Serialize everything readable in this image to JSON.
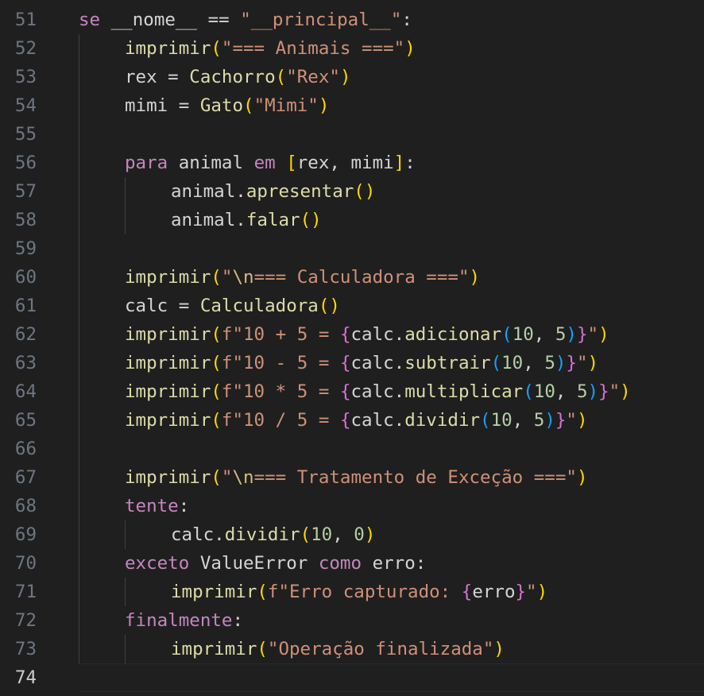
{
  "editor": {
    "current_line": "74",
    "lines": [
      {
        "num": "51",
        "indent": 0,
        "tokens": [
          {
            "t": "se",
            "c": "kw"
          },
          {
            "t": " __nome__ ",
            "c": "tx"
          },
          {
            "t": "==",
            "c": "op"
          },
          {
            "t": " ",
            "c": "tx"
          },
          {
            "t": "\"__principal__\"",
            "c": "st"
          },
          {
            "t": ":",
            "c": "tx"
          }
        ]
      },
      {
        "num": "52",
        "indent": 1,
        "tokens": [
          {
            "t": "imprimir",
            "c": "fn"
          },
          {
            "t": "(",
            "c": "br1"
          },
          {
            "t": "\"=== Animais ===\"",
            "c": "st"
          },
          {
            "t": ")",
            "c": "br1"
          }
        ]
      },
      {
        "num": "53",
        "indent": 1,
        "tokens": [
          {
            "t": "rex",
            "c": "tx"
          },
          {
            "t": " = ",
            "c": "op"
          },
          {
            "t": "Cachorro",
            "c": "fn"
          },
          {
            "t": "(",
            "c": "br1"
          },
          {
            "t": "\"Rex\"",
            "c": "st"
          },
          {
            "t": ")",
            "c": "br1"
          }
        ]
      },
      {
        "num": "54",
        "indent": 1,
        "tokens": [
          {
            "t": "mimi",
            "c": "tx"
          },
          {
            "t": " = ",
            "c": "op"
          },
          {
            "t": "Gato",
            "c": "fn"
          },
          {
            "t": "(",
            "c": "br1"
          },
          {
            "t": "\"Mimi\"",
            "c": "st"
          },
          {
            "t": ")",
            "c": "br1"
          }
        ]
      },
      {
        "num": "55",
        "indent": 0,
        "tokens": []
      },
      {
        "num": "56",
        "indent": 1,
        "tokens": [
          {
            "t": "para",
            "c": "kw"
          },
          {
            "t": " animal ",
            "c": "tx"
          },
          {
            "t": "em",
            "c": "kw"
          },
          {
            "t": " ",
            "c": "tx"
          },
          {
            "t": "[",
            "c": "br1"
          },
          {
            "t": "rex, mimi",
            "c": "tx"
          },
          {
            "t": "]",
            "c": "br1"
          },
          {
            "t": ":",
            "c": "tx"
          }
        ]
      },
      {
        "num": "57",
        "indent": 2,
        "tokens": [
          {
            "t": "animal.",
            "c": "tx"
          },
          {
            "t": "apresentar",
            "c": "fn"
          },
          {
            "t": "()",
            "c": "br1"
          }
        ]
      },
      {
        "num": "58",
        "indent": 2,
        "tokens": [
          {
            "t": "animal.",
            "c": "tx"
          },
          {
            "t": "falar",
            "c": "fn"
          },
          {
            "t": "()",
            "c": "br1"
          }
        ]
      },
      {
        "num": "59",
        "indent": 0,
        "tokens": []
      },
      {
        "num": "60",
        "indent": 1,
        "tokens": [
          {
            "t": "imprimir",
            "c": "fn"
          },
          {
            "t": "(",
            "c": "br1"
          },
          {
            "t": "\"",
            "c": "st"
          },
          {
            "t": "\\n",
            "c": "es"
          },
          {
            "t": "=== Calculadora ===\"",
            "c": "st"
          },
          {
            "t": ")",
            "c": "br1"
          }
        ]
      },
      {
        "num": "61",
        "indent": 1,
        "tokens": [
          {
            "t": "calc",
            "c": "tx"
          },
          {
            "t": " = ",
            "c": "op"
          },
          {
            "t": "Calculadora",
            "c": "fn"
          },
          {
            "t": "()",
            "c": "br1"
          }
        ]
      },
      {
        "num": "62",
        "indent": 1,
        "tokens": [
          {
            "t": "imprimir",
            "c": "fn"
          },
          {
            "t": "(",
            "c": "br1"
          },
          {
            "t": "f\"10 + 5 = ",
            "c": "st"
          },
          {
            "t": "{",
            "c": "br2"
          },
          {
            "t": "calc.",
            "c": "tx"
          },
          {
            "t": "adicionar",
            "c": "fn"
          },
          {
            "t": "(",
            "c": "br3"
          },
          {
            "t": "10",
            "c": "nu"
          },
          {
            "t": ", ",
            "c": "tx"
          },
          {
            "t": "5",
            "c": "nu"
          },
          {
            "t": ")",
            "c": "br3"
          },
          {
            "t": "}",
            "c": "br2"
          },
          {
            "t": "\"",
            "c": "st"
          },
          {
            "t": ")",
            "c": "br1"
          }
        ]
      },
      {
        "num": "63",
        "indent": 1,
        "tokens": [
          {
            "t": "imprimir",
            "c": "fn"
          },
          {
            "t": "(",
            "c": "br1"
          },
          {
            "t": "f\"10 - 5 = ",
            "c": "st"
          },
          {
            "t": "{",
            "c": "br2"
          },
          {
            "t": "calc.",
            "c": "tx"
          },
          {
            "t": "subtrair",
            "c": "fn"
          },
          {
            "t": "(",
            "c": "br3"
          },
          {
            "t": "10",
            "c": "nu"
          },
          {
            "t": ", ",
            "c": "tx"
          },
          {
            "t": "5",
            "c": "nu"
          },
          {
            "t": ")",
            "c": "br3"
          },
          {
            "t": "}",
            "c": "br2"
          },
          {
            "t": "\"",
            "c": "st"
          },
          {
            "t": ")",
            "c": "br1"
          }
        ]
      },
      {
        "num": "64",
        "indent": 1,
        "tokens": [
          {
            "t": "imprimir",
            "c": "fn"
          },
          {
            "t": "(",
            "c": "br1"
          },
          {
            "t": "f\"10 * 5 = ",
            "c": "st"
          },
          {
            "t": "{",
            "c": "br2"
          },
          {
            "t": "calc.",
            "c": "tx"
          },
          {
            "t": "multiplicar",
            "c": "fn"
          },
          {
            "t": "(",
            "c": "br3"
          },
          {
            "t": "10",
            "c": "nu"
          },
          {
            "t": ", ",
            "c": "tx"
          },
          {
            "t": "5",
            "c": "nu"
          },
          {
            "t": ")",
            "c": "br3"
          },
          {
            "t": "}",
            "c": "br2"
          },
          {
            "t": "\"",
            "c": "st"
          },
          {
            "t": ")",
            "c": "br1"
          }
        ]
      },
      {
        "num": "65",
        "indent": 1,
        "tokens": [
          {
            "t": "imprimir",
            "c": "fn"
          },
          {
            "t": "(",
            "c": "br1"
          },
          {
            "t": "f\"10 / 5 = ",
            "c": "st"
          },
          {
            "t": "{",
            "c": "br2"
          },
          {
            "t": "calc.",
            "c": "tx"
          },
          {
            "t": "dividir",
            "c": "fn"
          },
          {
            "t": "(",
            "c": "br3"
          },
          {
            "t": "10",
            "c": "nu"
          },
          {
            "t": ", ",
            "c": "tx"
          },
          {
            "t": "5",
            "c": "nu"
          },
          {
            "t": ")",
            "c": "br3"
          },
          {
            "t": "}",
            "c": "br2"
          },
          {
            "t": "\"",
            "c": "st"
          },
          {
            "t": ")",
            "c": "br1"
          }
        ]
      },
      {
        "num": "66",
        "indent": 0,
        "tokens": []
      },
      {
        "num": "67",
        "indent": 1,
        "tokens": [
          {
            "t": "imprimir",
            "c": "fn"
          },
          {
            "t": "(",
            "c": "br1"
          },
          {
            "t": "\"",
            "c": "st"
          },
          {
            "t": "\\n",
            "c": "es"
          },
          {
            "t": "=== Tratamento de Exceção ===\"",
            "c": "st"
          },
          {
            "t": ")",
            "c": "br1"
          }
        ]
      },
      {
        "num": "68",
        "indent": 1,
        "tokens": [
          {
            "t": "tente",
            "c": "kw"
          },
          {
            "t": ":",
            "c": "tx"
          }
        ]
      },
      {
        "num": "69",
        "indent": 2,
        "tokens": [
          {
            "t": "calc.",
            "c": "tx"
          },
          {
            "t": "dividir",
            "c": "fn"
          },
          {
            "t": "(",
            "c": "br1"
          },
          {
            "t": "10",
            "c": "nu"
          },
          {
            "t": ", ",
            "c": "tx"
          },
          {
            "t": "0",
            "c": "nu"
          },
          {
            "t": ")",
            "c": "br1"
          }
        ]
      },
      {
        "num": "70",
        "indent": 1,
        "tokens": [
          {
            "t": "exceto",
            "c": "kw"
          },
          {
            "t": " ValueError ",
            "c": "tx"
          },
          {
            "t": "como",
            "c": "kw"
          },
          {
            "t": " erro:",
            "c": "tx"
          }
        ]
      },
      {
        "num": "71",
        "indent": 2,
        "tokens": [
          {
            "t": "imprimir",
            "c": "fn"
          },
          {
            "t": "(",
            "c": "br1"
          },
          {
            "t": "f\"Erro capturado: ",
            "c": "st"
          },
          {
            "t": "{",
            "c": "br2"
          },
          {
            "t": "erro",
            "c": "tx"
          },
          {
            "t": "}",
            "c": "br2"
          },
          {
            "t": "\"",
            "c": "st"
          },
          {
            "t": ")",
            "c": "br1"
          }
        ]
      },
      {
        "num": "72",
        "indent": 1,
        "tokens": [
          {
            "t": "finalmente",
            "c": "kw"
          },
          {
            "t": ":",
            "c": "tx"
          }
        ]
      },
      {
        "num": "73",
        "indent": 2,
        "tokens": [
          {
            "t": "imprimir",
            "c": "fn"
          },
          {
            "t": "(",
            "c": "br1"
          },
          {
            "t": "\"Operação finalizada\"",
            "c": "st"
          },
          {
            "t": ")",
            "c": "br1"
          }
        ]
      },
      {
        "num": "74",
        "indent": 0,
        "tokens": []
      }
    ]
  }
}
